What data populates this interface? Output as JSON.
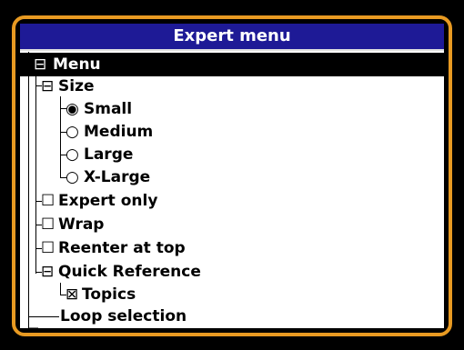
{
  "window": {
    "title": "Expert menu"
  },
  "tree": [
    {
      "id": "menu",
      "label": "Menu",
      "control": "minus-box-icon",
      "glyph": "⊟",
      "selected": true
    },
    {
      "id": "size",
      "label": "Size",
      "control": "minus-box-icon",
      "glyph": "⊟"
    },
    {
      "id": "small",
      "label": "Small",
      "control": "radio-checked-icon",
      "glyph": "◉"
    },
    {
      "id": "medium",
      "label": "Medium",
      "control": "radio-unchecked-icon",
      "glyph": "○"
    },
    {
      "id": "large",
      "label": "Large",
      "control": "radio-unchecked-icon",
      "glyph": "○"
    },
    {
      "id": "xlarge",
      "label": "X-Large",
      "control": "radio-unchecked-icon",
      "glyph": "○"
    },
    {
      "id": "expert-only",
      "label": "Expert only",
      "control": "checkbox-unchecked-icon",
      "glyph": "☐"
    },
    {
      "id": "wrap",
      "label": "Wrap",
      "control": "checkbox-unchecked-icon",
      "glyph": "☐"
    },
    {
      "id": "reenter",
      "label": "Reenter at top",
      "control": "checkbox-unchecked-icon",
      "glyph": "☐"
    },
    {
      "id": "quick-reference",
      "label": "Quick Reference",
      "control": "minus-box-icon",
      "glyph": "⊟"
    },
    {
      "id": "topics",
      "label": "Topics",
      "control": "checkbox-crossed-icon",
      "glyph": "⊠"
    },
    {
      "id": "loop-selection",
      "label": "Loop selection",
      "control": "none",
      "glyph": ""
    }
  ],
  "colors": {
    "frame_border": "#e89a22",
    "titlebar": "#1e1a96",
    "selection": "#000000",
    "screen_bg": "#ffffff"
  }
}
